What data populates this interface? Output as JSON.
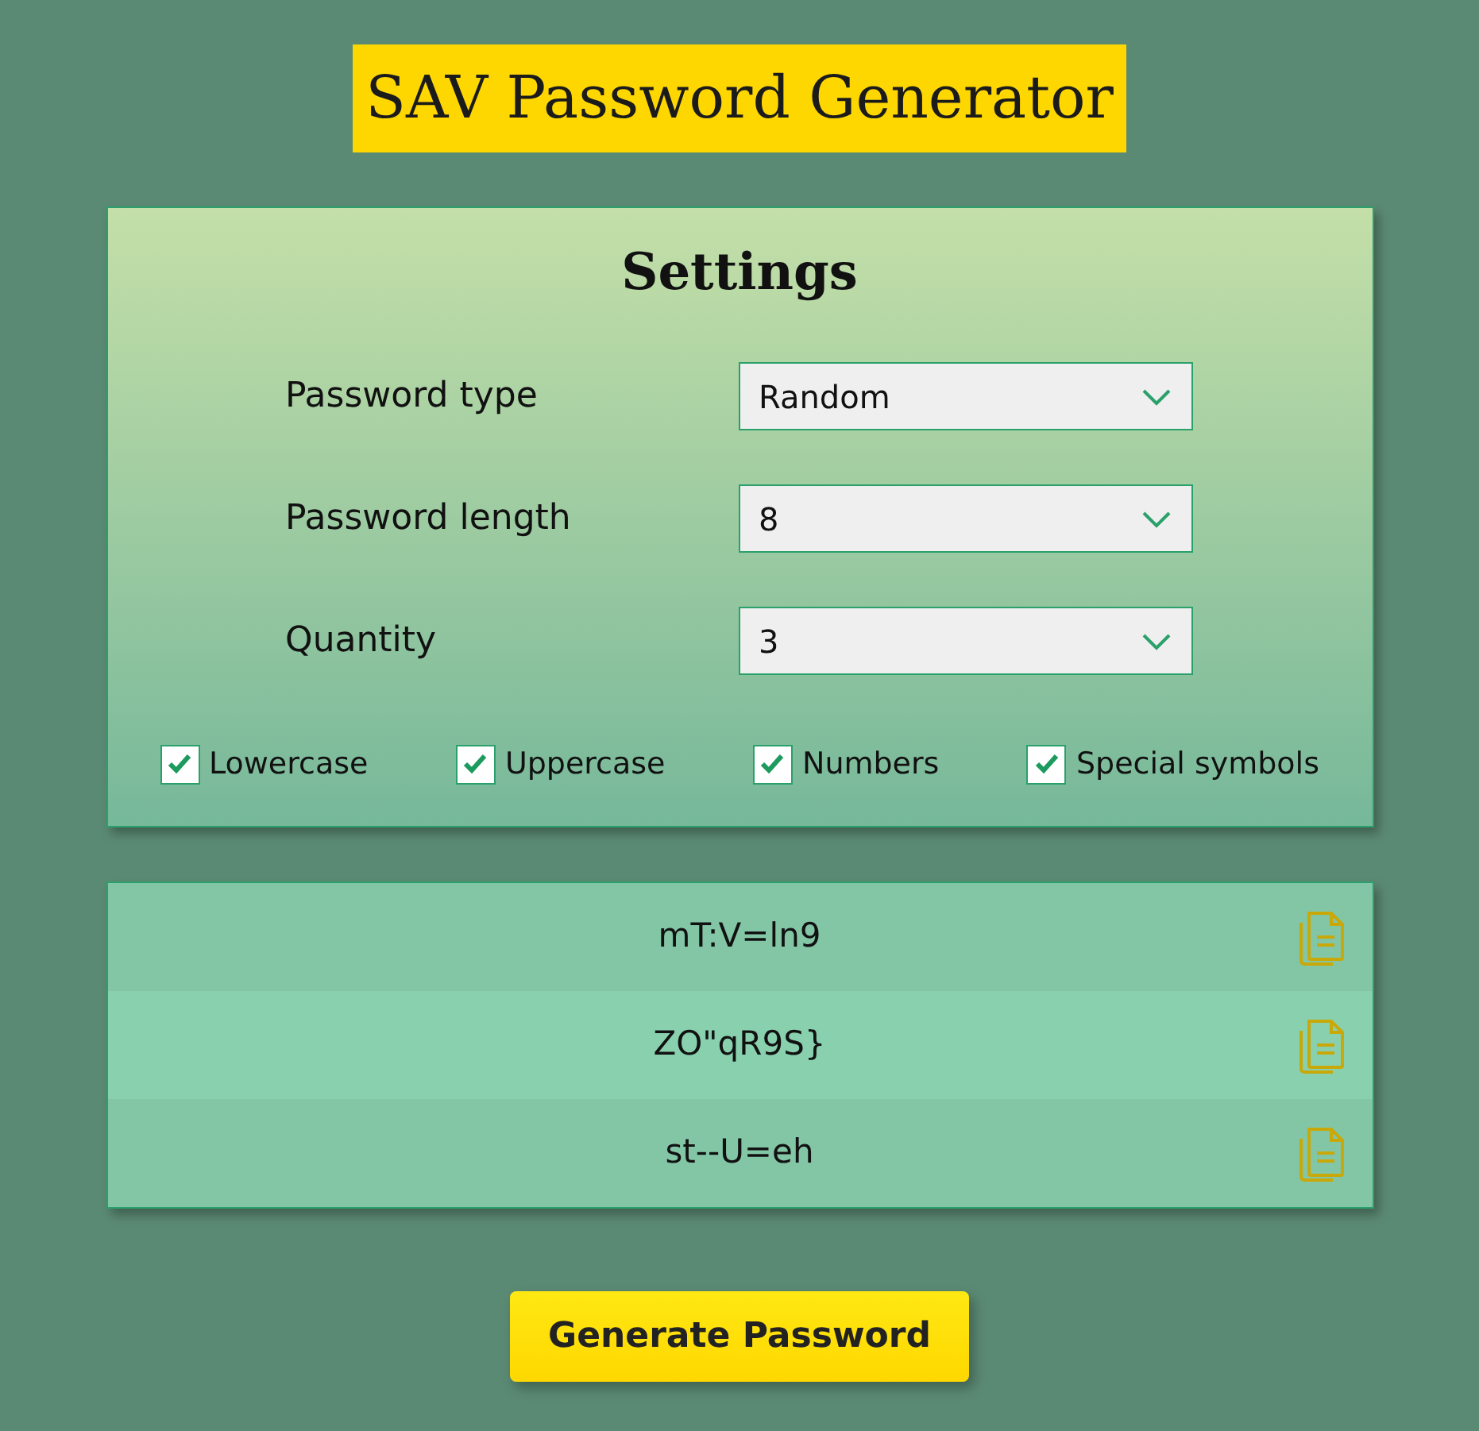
{
  "title": "SAV Password Generator",
  "settings": {
    "heading": "Settings",
    "fields": [
      {
        "label": "Password type",
        "value": "Random"
      },
      {
        "label": "Password length",
        "value": "8"
      },
      {
        "label": "Quantity",
        "value": "3"
      }
    ],
    "options": [
      {
        "label": "Lowercase",
        "checked": true
      },
      {
        "label": "Uppercase",
        "checked": true
      },
      {
        "label": "Numbers",
        "checked": true
      },
      {
        "label": "Special symbols",
        "checked": true
      }
    ]
  },
  "passwords": [
    "mT:V=ln9",
    "ZO\"qR9S}",
    "st--U=eh"
  ],
  "generate_button": "Generate Password"
}
